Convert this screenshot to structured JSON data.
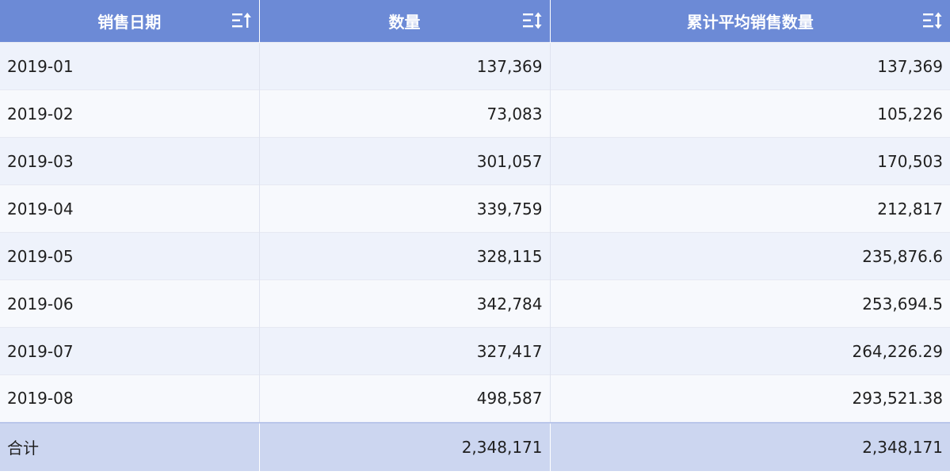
{
  "table": {
    "columns": [
      {
        "label": "销售日期",
        "sort_icon": "sort-ascending-icon"
      },
      {
        "label": "数量",
        "sort_icon": "sort-icon"
      },
      {
        "label": "累计平均销售数量",
        "sort_icon": "sort-icon"
      }
    ],
    "rows": [
      {
        "date": "2019-01",
        "quantity": "137,369",
        "cumulative_avg": "137,369"
      },
      {
        "date": "2019-02",
        "quantity": "73,083",
        "cumulative_avg": "105,226"
      },
      {
        "date": "2019-03",
        "quantity": "301,057",
        "cumulative_avg": "170,503"
      },
      {
        "date": "2019-04",
        "quantity": "339,759",
        "cumulative_avg": "212,817"
      },
      {
        "date": "2019-05",
        "quantity": "328,115",
        "cumulative_avg": "235,876.6"
      },
      {
        "date": "2019-06",
        "quantity": "342,784",
        "cumulative_avg": "253,694.5"
      },
      {
        "date": "2019-07",
        "quantity": "327,417",
        "cumulative_avg": "264,226.29"
      },
      {
        "date": "2019-08",
        "quantity": "498,587",
        "cumulative_avg": "293,521.38"
      }
    ],
    "total": {
      "label": "合计",
      "quantity": "2,348,171",
      "cumulative_avg": "2,348,171"
    }
  },
  "colors": {
    "header_bg": "#6c8ad6",
    "row_odd": "#eef2fb",
    "row_even": "#f7f9fd",
    "footer_bg": "#ccd6f0"
  }
}
